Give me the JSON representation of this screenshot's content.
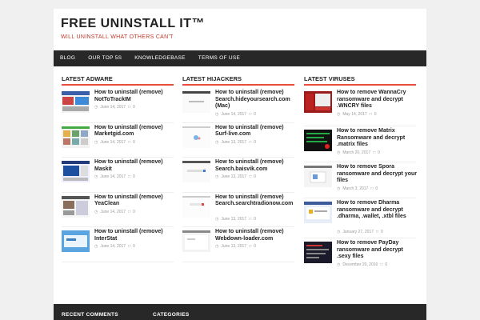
{
  "site": {
    "title": "FREE UNINSTALL IT™",
    "tagline": "WILL UNINSTALL WHAT OTHERS CAN'T"
  },
  "nav": [
    "BLOG",
    "OUR TOP 5S",
    "KNOWLEDGEBASE",
    "TERMS OF USE"
  ],
  "columns": [
    {
      "title": "LATEST ADWARE",
      "items": [
        {
          "title": "How to uninstall (remove) NotToTrackIM",
          "date": "June 14, 2017",
          "comments": "0"
        },
        {
          "title": "How to uninstall (remove) Marketgid.com",
          "date": "June 14, 2017",
          "comments": "0"
        },
        {
          "title": "How to uninstall (remove) Maskit",
          "date": "June 14, 2017",
          "comments": "0"
        },
        {
          "title": "How to uninstall (remove) YeaClean",
          "date": "June 14, 2017",
          "comments": "0"
        },
        {
          "title": "How to uninstall (remove) InterStat",
          "date": "June 14, 2017",
          "comments": "0"
        }
      ]
    },
    {
      "title": "LATEST HIJACKERS",
      "items": [
        {
          "title": "How to uninstall (remove) Search.hideyoursearch.com (Mac)",
          "date": "June 14, 2017",
          "comments": "0"
        },
        {
          "title": "How to uninstall (remove) Surf-live.com",
          "date": "June 13, 2017",
          "comments": "0"
        },
        {
          "title": "How to uninstall (remove) Search.baisvik.com",
          "date": "June 13, 2017",
          "comments": "0"
        },
        {
          "title": "How to uninstall (remove) Search.searchtradionow.com",
          "date": "June 13, 2017",
          "comments": "0"
        },
        {
          "title": "How to uninstall (remove) Webdown-loader.com",
          "date": "June 13, 2017",
          "comments": "0"
        }
      ]
    },
    {
      "title": "LATEST VIRUSES",
      "items": [
        {
          "title": "How to remove WannaCry ransomware and decrypt .WNCRY files",
          "date": "May 14, 2017",
          "comments": "0"
        },
        {
          "title": "How to remove Matrix Ransomware and decrypt .matrix files",
          "date": "March 20, 2017",
          "comments": "0"
        },
        {
          "title": "How to remove Spora ransomware and decrypt your files",
          "date": "March 3, 2017",
          "comments": "0"
        },
        {
          "title": "How to remove Dharma ransomware and decrypt .dharma, .wallet, .xtbl files",
          "date": "January 27, 2017",
          "comments": "0"
        },
        {
          "title": "How to remove PayDay ransomware and decrypt .sexy files",
          "date": "December 20, 2016",
          "comments": "0"
        }
      ]
    }
  ],
  "footer": {
    "recent_comments": "RECENT COMMENTS",
    "categories": "CATEGORIES"
  },
  "colors": {
    "accent": "#e74c3c",
    "nav_bg": "#282828",
    "tagline": "#c0392b"
  }
}
